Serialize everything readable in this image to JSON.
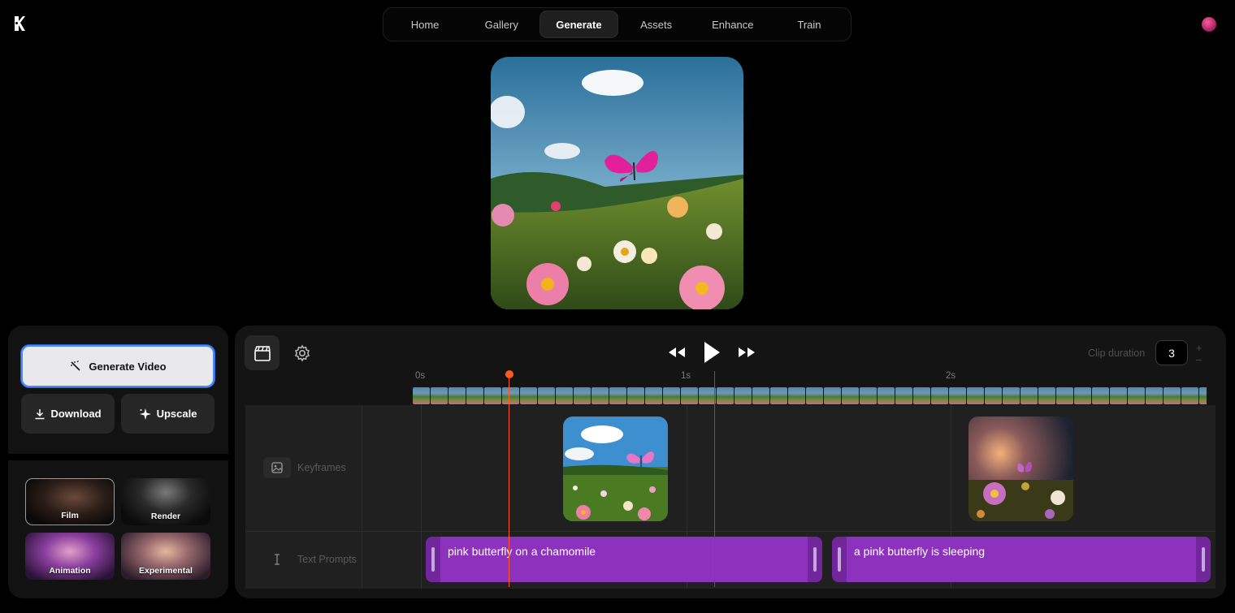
{
  "app": {
    "logo_icon": "k-logo-icon",
    "nav_tabs": [
      {
        "label": "Home",
        "active": false
      },
      {
        "label": "Gallery",
        "active": false
      },
      {
        "label": "Generate",
        "active": true
      },
      {
        "label": "Assets",
        "active": false
      },
      {
        "label": "Enhance",
        "active": false
      },
      {
        "label": "Train",
        "active": false
      }
    ],
    "accent": "#4b8af5"
  },
  "actions": {
    "generate_label": "Generate Video",
    "download_label": "Download",
    "upscale_label": "Upscale"
  },
  "styles": [
    {
      "label": "Film",
      "selected": true
    },
    {
      "label": "Render",
      "selected": false
    },
    {
      "label": "Animation",
      "selected": false
    },
    {
      "label": "Experimental",
      "selected": false
    }
  ],
  "timeline": {
    "clip_duration_label": "Clip duration",
    "clip_duration_value": "3",
    "stepper_plus": "+",
    "stepper_minus": "–",
    "ruler": [
      "0s",
      "1s",
      "2s"
    ],
    "tracks": {
      "keyframes_label": "Keyframes",
      "prompts_label": "Text Prompts"
    },
    "prompts": [
      {
        "text": "pink butterfly on a chamomile"
      },
      {
        "text": "a pink butterfly is sleeping"
      }
    ],
    "playhead_color": "#ff5a1f",
    "prompt_color": "#8c32bd"
  }
}
